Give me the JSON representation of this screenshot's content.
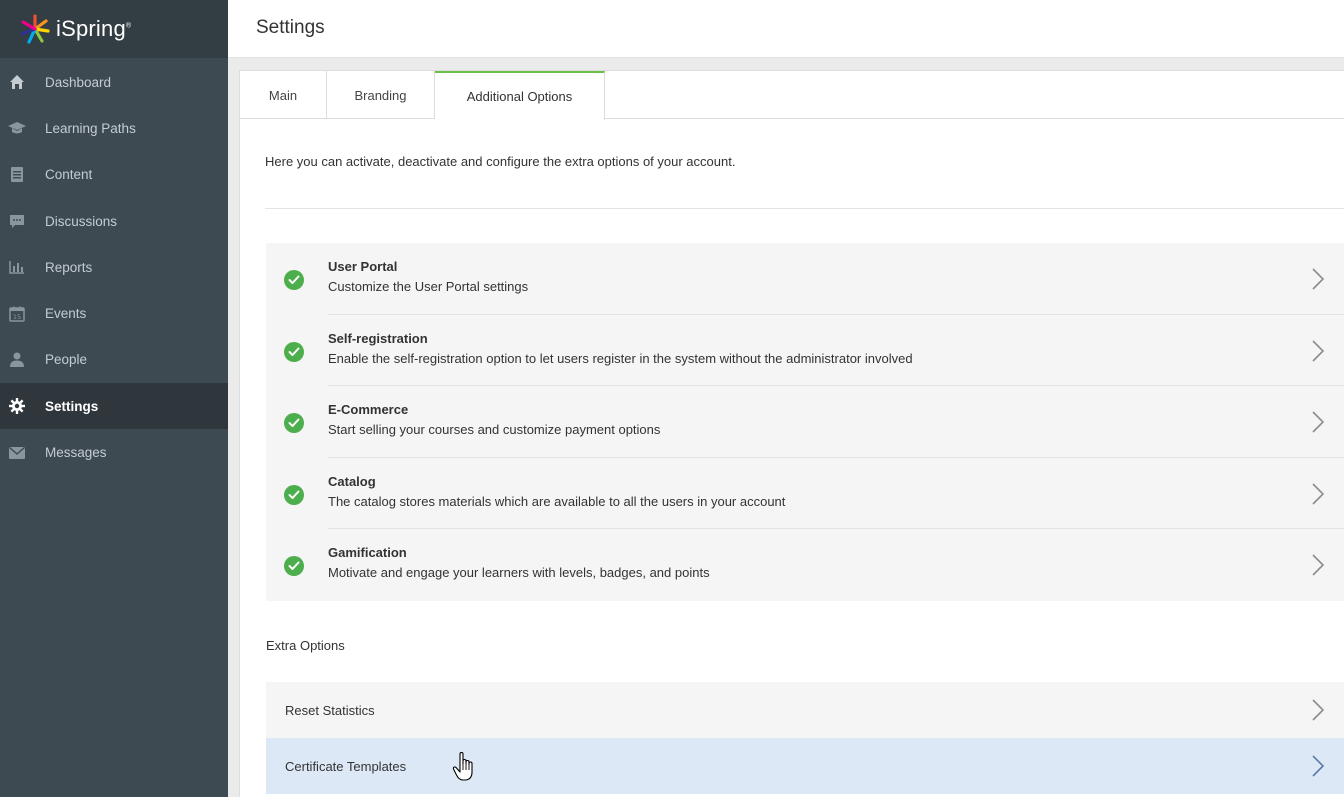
{
  "app": {
    "logo_text": "iSpring",
    "logo_mark": "®",
    "page_title": "Settings"
  },
  "sidebar": {
    "items": [
      {
        "label": "Dashboard",
        "icon": "home-icon"
      },
      {
        "label": "Learning Paths",
        "icon": "graduation-cap-icon"
      },
      {
        "label": "Content",
        "icon": "document-icon"
      },
      {
        "label": "Discussions",
        "icon": "chat-icon"
      },
      {
        "label": "Reports",
        "icon": "bar-chart-icon"
      },
      {
        "label": "Events",
        "icon": "calendar-icon"
      },
      {
        "label": "People",
        "icon": "person-icon"
      },
      {
        "label": "Settings",
        "icon": "gear-icon",
        "active": true
      },
      {
        "label": "Messages",
        "icon": "envelope-icon"
      }
    ]
  },
  "tabs": [
    {
      "label": "Main"
    },
    {
      "label": "Branding"
    },
    {
      "label": "Additional Options",
      "active": true
    }
  ],
  "intro_text": "Here you can activate, deactivate and configure the extra options of your account.",
  "options": [
    {
      "title": "User Portal",
      "desc": "Customize the User Portal settings",
      "enabled": true
    },
    {
      "title": "Self-registration",
      "desc": "Enable the self-registration option to let users register in the system without the administrator involved",
      "enabled": true
    },
    {
      "title": "E-Commerce",
      "desc": "Start selling your courses and customize payment options",
      "enabled": true
    },
    {
      "title": "Catalog",
      "desc": "The catalog stores materials which are available to all the users in your account",
      "enabled": true
    },
    {
      "title": "Gamification",
      "desc": "Motivate and engage your learners with levels, badges, and points",
      "enabled": true
    }
  ],
  "extra": {
    "label": "Extra Options",
    "items": [
      {
        "label": "Reset Statistics"
      },
      {
        "label": "Certificate Templates",
        "hovered": true
      }
    ]
  },
  "colors": {
    "accent_green": "#4cae4c",
    "tab_active_border": "#6cc04a",
    "sidebar_bg": "#3d4a52",
    "hover_row": "#dde8f7"
  }
}
